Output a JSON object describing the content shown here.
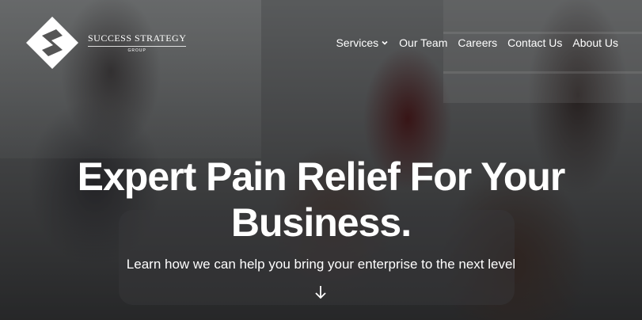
{
  "brand": {
    "name": "SUCCESS STRATEGY",
    "sub": "GROUP",
    "logo_icon": "stylized-s-diamond-icon"
  },
  "nav": {
    "items": [
      {
        "label": "Services",
        "icon": "chevron-down-icon"
      },
      {
        "label": "Our Team"
      },
      {
        "label": "Careers"
      },
      {
        "label": "Contact Us"
      },
      {
        "label": "About Us"
      }
    ]
  },
  "hero": {
    "headline_line1": "Expert Pain Relief For Your",
    "headline_line2": "Business.",
    "subtitle": "Learn how we can help you bring your enterprise to the next level",
    "scroll_icon": "arrow-down-icon"
  }
}
